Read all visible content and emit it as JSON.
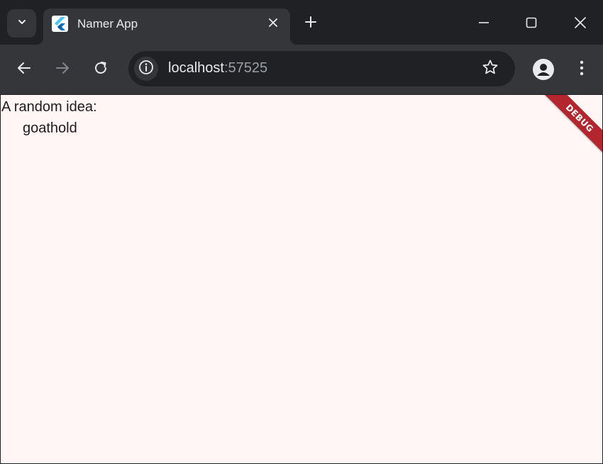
{
  "browser": {
    "tab": {
      "title": "Namer App",
      "favicon": "flutter-logo-icon"
    },
    "address_bar": {
      "host": "localhost",
      "port": ":57525"
    },
    "icons": {
      "tab_search": "chevron-down-icon",
      "tab_close": "close-icon",
      "new_tab": "plus-icon",
      "minimize": "minimize-icon",
      "maximize": "maximize-icon",
      "close_window": "close-icon",
      "back": "arrow-left-icon",
      "forward": "arrow-right-icon",
      "reload": "reload-icon",
      "site_info": "info-icon",
      "bookmark": "star-icon",
      "profile": "person-icon",
      "menu": "more-vertical-icon"
    },
    "colors": {
      "frame": "#202124",
      "toolbar": "#35363a",
      "text": "#e8eaed"
    }
  },
  "app": {
    "label": "A random idea:",
    "word_pair": "goathold",
    "debug_banner": "DEBUG",
    "colors": {
      "background": "#fff6f5",
      "banner": "#b3262d"
    }
  }
}
